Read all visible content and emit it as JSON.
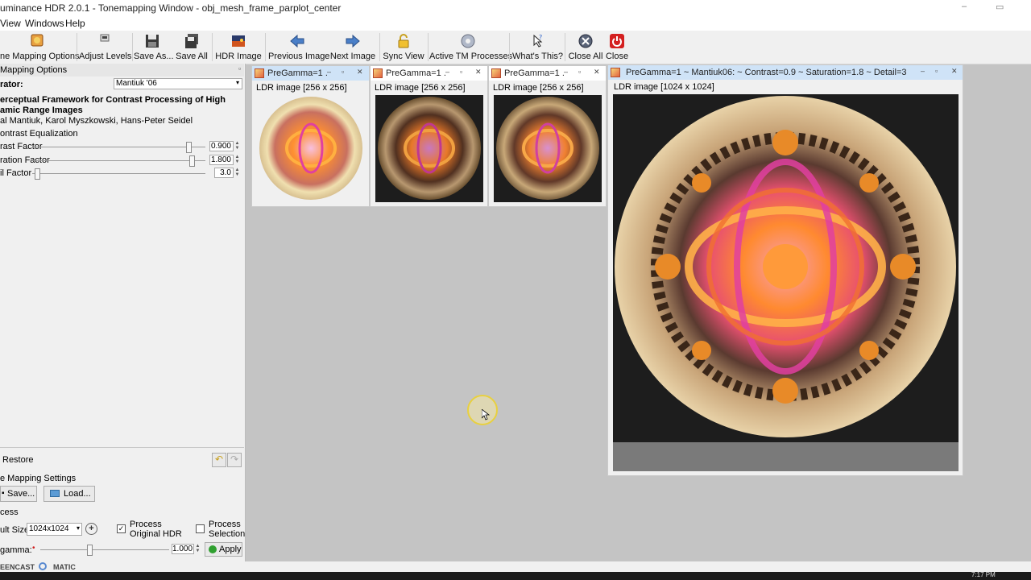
{
  "window": {
    "title": "uminance HDR 2.0.1 - Tonemapping Window - obj_mesh_frame_parplot_center",
    "minimize": "–",
    "restore": "▭"
  },
  "menu": [
    "View",
    "Windows",
    "Help"
  ],
  "toolbar": [
    {
      "label": "ne Mapping Options",
      "icon": "tonemap-options-icon"
    },
    {
      "label": "Adjust Levels",
      "icon": "levels-icon"
    },
    {
      "label": "Save As...",
      "icon": "save-icon"
    },
    {
      "label": "Save All",
      "icon": "save-all-icon"
    },
    {
      "label": "HDR Image",
      "icon": "hdr-image-icon"
    },
    {
      "label": "Previous Image",
      "icon": "arrow-left-icon"
    },
    {
      "label": "Next Image",
      "icon": "arrow-right-icon"
    },
    {
      "label": "Sync View",
      "icon": "lock-icon"
    },
    {
      "label": "Active TM Processes",
      "icon": "gear-icon"
    },
    {
      "label": "What's This?",
      "icon": "help-pointer-icon"
    },
    {
      "label": "Close All",
      "icon": "close-all-icon"
    },
    {
      "label": "Close",
      "icon": "power-icon"
    }
  ],
  "left_panel": {
    "title": "Mapping Options",
    "operator_label": "rator:",
    "operator_value": "Mantiuk '06",
    "paper_title_1": "erceptual Framework for Contrast Processing of High",
    "paper_title_2": "amic Range Images",
    "authors": "al Mantiuk, Karol Myszkowski, Hans-Peter Seidel",
    "contrast_eq_label": "ontrast Equalization",
    "sliders": [
      {
        "label": "rast Factor",
        "value": "0.900",
        "fraction": 0.9
      },
      {
        "label": "ration Factor",
        "value": "1.800",
        "fraction": 0.92
      },
      {
        "label": "il Factor",
        "value": "3.0",
        "fraction": 0.03
      }
    ],
    "restore_label": "Restore",
    "settings_title": "e Mapping Settings",
    "save_label": "Save...",
    "load_label": "Load...",
    "process_title": "cess",
    "result_size_label": "ult Size:",
    "result_size_value": "1024x1024",
    "process_original_label_1": "Process",
    "process_original_label_2": "Original HDR",
    "process_original_checked": "✓",
    "process_selection_label_1": "Process",
    "process_selection_label_2": "Selection",
    "gamma_label": "gamma:",
    "gamma_value": "1.000",
    "apply_label": "Apply"
  },
  "subwindows": [
    {
      "title": "PreGamma=1 ...",
      "info": "LDR image [256 x 256]",
      "active": true
    },
    {
      "title": "PreGamma=1 ...",
      "info": "LDR image [256 x 256]",
      "active": false
    },
    {
      "title": "PreGamma=1 ...",
      "info": "LDR image [256 x 256]",
      "active": false
    },
    {
      "title": "PreGamma=1 ~ Mantiuk06: ~ Contrast=0.9 ~ Saturation=1.8 ~ Detail=3",
      "info": "LDR image [1024 x 1024]",
      "active": true
    }
  ],
  "status": {
    "watermark": "EENCAST",
    "watermark2": "MATIC",
    "clock": "7:17 PM"
  },
  "colors": {
    "active_title": "#cfe3f7",
    "panel_bg": "#f0f0f0",
    "mdi_bg": "#c4c4c4"
  }
}
